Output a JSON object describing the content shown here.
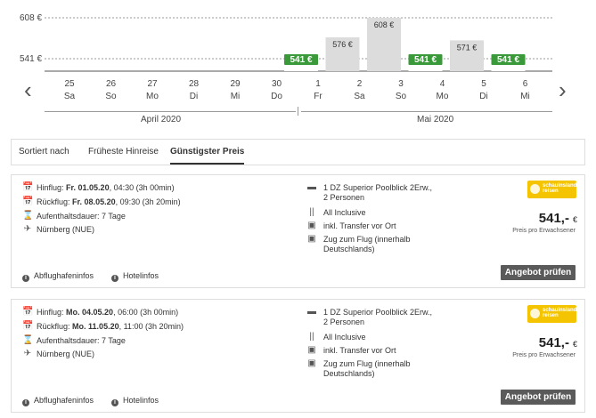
{
  "chart_data": {
    "type": "bar",
    "y_ticks": [
      "608 €",
      "541 €"
    ],
    "bars": [
      {
        "label": "541 €",
        "value": 541,
        "highlight": true
      },
      {
        "label": "576 €",
        "value": 576,
        "highlight": false
      },
      {
        "label": "608 €",
        "value": 608,
        "highlight": false
      },
      {
        "label": "541 €",
        "value": 541,
        "highlight": true
      },
      {
        "label": "571 €",
        "value": 571,
        "highlight": false
      },
      {
        "label": "541 €",
        "value": 541,
        "highlight": true
      }
    ],
    "colors": {
      "highlight": "#3a9a3a",
      "normal": "#dcdcdc"
    }
  },
  "dates": [
    {
      "day": "25",
      "weekday": "Sa"
    },
    {
      "day": "26",
      "weekday": "So"
    },
    {
      "day": "27",
      "weekday": "Mo"
    },
    {
      "day": "28",
      "weekday": "Di"
    },
    {
      "day": "29",
      "weekday": "Mi"
    },
    {
      "day": "30",
      "weekday": "Do"
    },
    {
      "day": "1",
      "weekday": "Fr"
    },
    {
      "day": "2",
      "weekday": "Sa"
    },
    {
      "day": "3",
      "weekday": "So"
    },
    {
      "day": "4",
      "weekday": "Mo"
    },
    {
      "day": "5",
      "weekday": "Di"
    },
    {
      "day": "6",
      "weekday": "Mi"
    }
  ],
  "months": {
    "april": "April 2020",
    "mai": "Mai 2020"
  },
  "nav": {
    "prev_icon": "chevron-left-icon",
    "next_icon": "chevron-right-icon"
  },
  "sort": {
    "label": "Sortiert nach",
    "options": [
      "Früheste Hinreise",
      "Günstigster Preis"
    ],
    "active": "Günstigster Preis"
  },
  "offers": [
    {
      "hinflug_label": "Hinflug:",
      "hinflug_date": "Fr. 01.05.20",
      "hinflug_rest": ", 04:30 (3h 00min)",
      "rueckflug_label": "Rückflug:",
      "rueckflug_date": "Fr. 08.05.20",
      "rueckflug_rest": ", 09:30 (3h 20min)",
      "aufenthalt": "Aufenthaltsdauer: 7 Tage",
      "airport": "Nürnberg (NUE)",
      "room_line1": "1 DZ Superior Poolblick 2Erw.,",
      "room_line2": "2 Personen",
      "board": "All Inclusive",
      "transfer": "inkl. Transfer vor Ort",
      "train_line1": "Zug zum Flug (innerhalb",
      "train_line2": "Deutschlands)",
      "price": "541,-",
      "currency": "€",
      "price_sub": "Preis pro Erwachsener",
      "logo_line1": "schauinsland",
      "logo_line2": "reisen",
      "airport_info": "Abflughafeninfos",
      "hotel_info": "Hotelinfos",
      "button": "Angebot prüfen"
    },
    {
      "hinflug_label": "Hinflug:",
      "hinflug_date": "Mo. 04.05.20",
      "hinflug_rest": ", 06:00 (3h 00min)",
      "rueckflug_label": "Rückflug:",
      "rueckflug_date": "Mo. 11.05.20",
      "rueckflug_rest": ", 11:00 (3h 20min)",
      "aufenthalt": "Aufenthaltsdauer: 7 Tage",
      "airport": "Nürnberg (NUE)",
      "room_line1": "1 DZ Superior Poolblick 2Erw.,",
      "room_line2": "2 Personen",
      "board": "All Inclusive",
      "transfer": "inkl. Transfer vor Ort",
      "train_line1": "Zug zum Flug (innerhalb",
      "train_line2": "Deutschlands)",
      "price": "541,-",
      "currency": "€",
      "price_sub": "Preis pro Erwachsener",
      "logo_line1": "schauinsland",
      "logo_line2": "reisen",
      "airport_info": "Abflughafeninfos",
      "hotel_info": "Hotelinfos",
      "button": "Angebot prüfen"
    }
  ]
}
